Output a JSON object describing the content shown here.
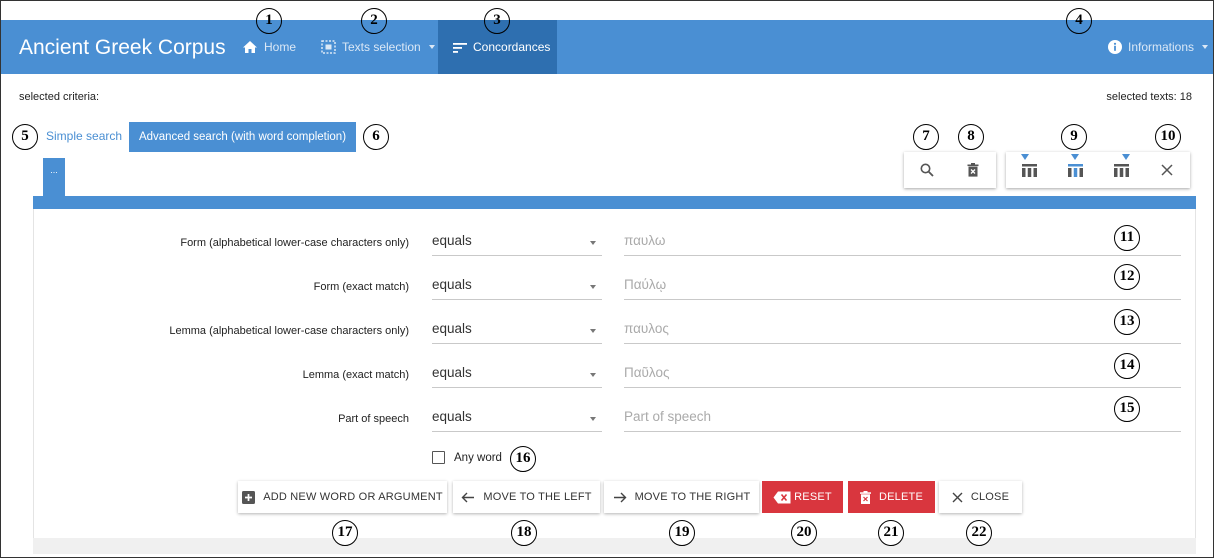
{
  "navbar": {
    "brand": "Ancient Greek Corpus",
    "home": "Home",
    "texts_selection": "Texts selection",
    "concordances": "Concordances",
    "informations": "Informations"
  },
  "criteria": {
    "selected_label": "selected criteria:",
    "selected_texts": "selected texts: 18"
  },
  "search_tabs": {
    "simple": "Simple search",
    "advanced": "Advanced search (with word completion)"
  },
  "word_tab": "...",
  "rows": [
    {
      "label": "Form (alphabetical lower-case characters only)",
      "operator": "equals",
      "placeholder": "παυλω"
    },
    {
      "label": "Form (exact match)",
      "operator": "equals",
      "placeholder": "Παύλῳ"
    },
    {
      "label": "Lemma (alphabetical lower-case characters only)",
      "operator": "equals",
      "placeholder": "παυλος"
    },
    {
      "label": "Lemma (exact match)",
      "operator": "equals",
      "placeholder": "Παῦλος"
    },
    {
      "label": "Part of speech",
      "operator": "equals",
      "placeholder": "Part of speech"
    }
  ],
  "any_word": "Any word",
  "buttons": {
    "add": "ADD NEW WORD OR ARGUMENT",
    "left": "MOVE TO THE LEFT",
    "right": "MOVE TO THE RIGHT",
    "reset": "RESET",
    "delete": "DELETE",
    "close": "CLOSE"
  },
  "callouts": [
    "1",
    "2",
    "3",
    "4",
    "5",
    "6",
    "7",
    "8",
    "9",
    "10",
    "11",
    "12",
    "13",
    "14",
    "15",
    "16",
    "17",
    "18",
    "19",
    "20",
    "21",
    "22"
  ],
  "colors": {
    "primary": "#4a8fd3",
    "primary_dark": "#2e6fb0",
    "danger": "#d9363e"
  }
}
